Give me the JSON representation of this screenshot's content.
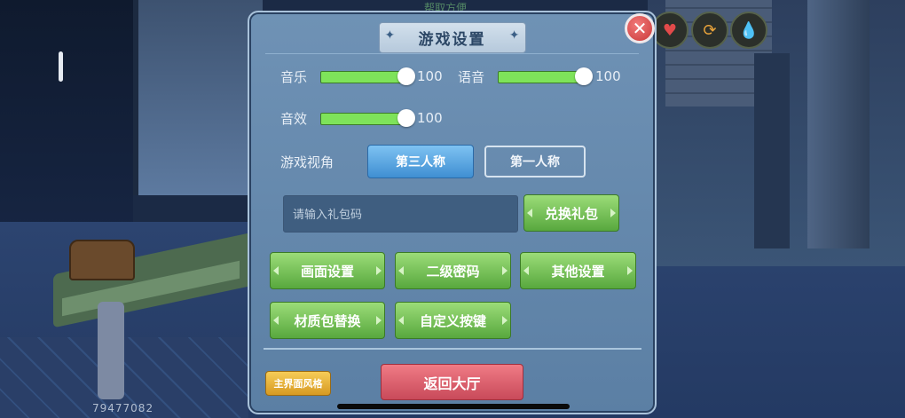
{
  "background": {
    "top_hint": "帮取方便",
    "player_id": "79477082"
  },
  "hud": {
    "heart_icon": "♥",
    "food_icon": "⟳",
    "water_icon": "💧"
  },
  "panel": {
    "title": "游戏设置",
    "close_icon": "✕",
    "music": {
      "label": "音乐",
      "value": "100",
      "level": 1.0
    },
    "voice": {
      "label": "语音",
      "value": "100",
      "level": 1.0
    },
    "sfx": {
      "label": "音效",
      "value": "100",
      "level": 1.0
    },
    "view": {
      "label": "游戏视角",
      "third_person": "第三人称",
      "first_person": "第一人称",
      "selected": "第三人称"
    },
    "gift": {
      "placeholder": "请输入礼包码",
      "redeem": "兑换礼包"
    },
    "buttons": {
      "graphics": "画面设置",
      "secondary_password": "二级密码",
      "other": "其他设置",
      "texture_pack": "材质包替换",
      "custom_keys": "自定义按键"
    },
    "footer": {
      "ui_style": "主界面风格",
      "back_lobby": "返回大厅"
    }
  },
  "colors": {
    "panel_bg": "#6384a9",
    "accent_green": "#7ee35a",
    "accent_red": "#d9505f",
    "accent_blue": "#3f8fd2",
    "accent_yellow": "#e7b23a"
  }
}
